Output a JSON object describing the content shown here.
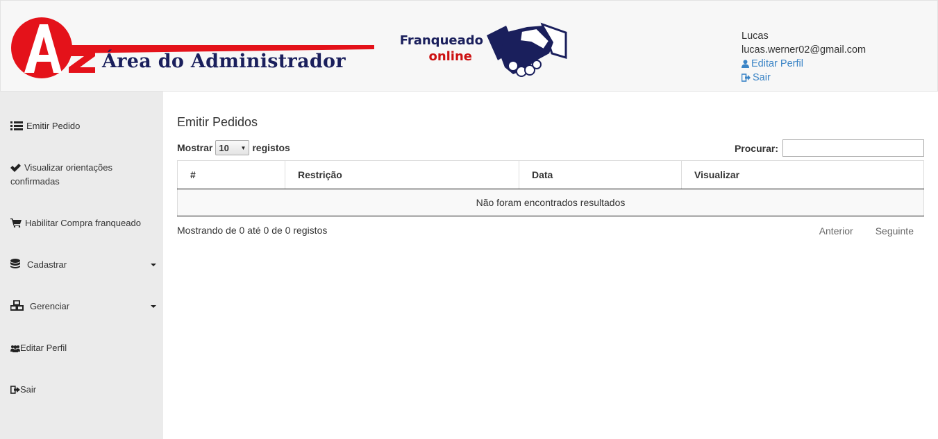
{
  "header": {
    "logo": {
      "letters": "AZ",
      "title": "Área do Administrador",
      "brand_red": "#e4121a",
      "brand_navy": "#1a1f5c"
    },
    "partner_logo": {
      "line1": "Franqueado",
      "line2": "online",
      "icon": "handshake-icon"
    },
    "user": {
      "name": "Lucas",
      "email": "lucas.werner02@gmail.com",
      "edit_profile": "Editar Perfil",
      "edit_profile_icon": "user-icon",
      "logout": "Sair",
      "logout_icon": "sign-out-icon",
      "link_color": "#3a84c6"
    }
  },
  "sidebar": {
    "items": [
      {
        "label": "Emitir Pedido",
        "icon": "list-icon"
      },
      {
        "label": "Visualizar orientações confirmadas",
        "icon": "check-icon"
      },
      {
        "label": "Habilitar Compra franqueado",
        "icon": "cart-icon"
      },
      {
        "label": "Cadastrar",
        "icon": "database-icon",
        "has_dropdown": true
      },
      {
        "label": "Gerenciar",
        "icon": "cubes-icon",
        "has_dropdown": true
      },
      {
        "label": "Editar Perfil",
        "icon": "users-icon"
      },
      {
        "label": "Sair",
        "icon": "sign-out-icon"
      }
    ]
  },
  "main": {
    "title": "Emitir Pedidos",
    "length_menu": {
      "prefix": "Mostrar",
      "value": "10",
      "suffix": "registos"
    },
    "search": {
      "label": "Procurar:",
      "value": ""
    },
    "table": {
      "columns": [
        "#",
        "Restrição",
        "Data",
        "Visualizar"
      ],
      "empty_message": "Não foram encontrados resultados"
    },
    "info": "Mostrando de 0 até 0 de 0 registos",
    "pagination": {
      "previous": "Anterior",
      "next": "Seguinte"
    }
  }
}
